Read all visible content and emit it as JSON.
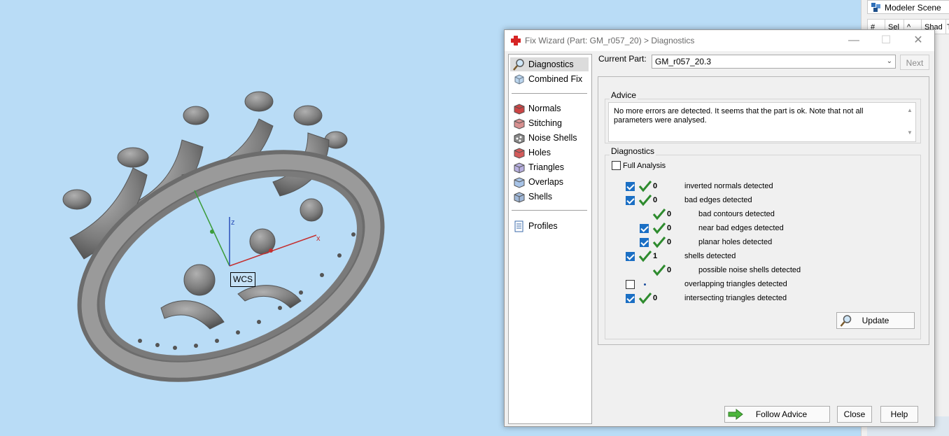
{
  "viewport": {
    "wcs_label": "WCS",
    "axis_x": "x",
    "axis_z": "z"
  },
  "scene_panel": {
    "tab_label": "Modeler Scene",
    "columns": [
      "#",
      "Sel",
      "^",
      "Shad",
      "T"
    ]
  },
  "dialog": {
    "title": "Fix Wizard (Part: GM_r057_20) > Diagnostics",
    "nav_items": [
      {
        "label": "Diagnostics",
        "icon": "magnifier-icon",
        "selected": true
      },
      {
        "label": "Combined Fix",
        "icon": "cube-icon"
      }
    ],
    "nav_items2": [
      {
        "label": "Normals",
        "icon": "normals-icon"
      },
      {
        "label": "Stitching",
        "icon": "stitching-icon"
      },
      {
        "label": "Noise Shells",
        "icon": "noise-shells-icon"
      },
      {
        "label": "Holes",
        "icon": "holes-icon"
      },
      {
        "label": "Triangles",
        "icon": "triangles-icon"
      },
      {
        "label": "Overlaps",
        "icon": "overlaps-icon"
      },
      {
        "label": "Shells",
        "icon": "shells-icon"
      }
    ],
    "nav_items3": [
      {
        "label": "Profiles",
        "icon": "profiles-icon"
      }
    ],
    "current_part_label": "Current Part:",
    "current_part_value": "GM_r057_20.3",
    "next_label": "Next",
    "advice_title": "Advice",
    "advice_text": "No more errors are detected. It seems that the part is ok. Note that not all parameters were analysed.",
    "diagnostics_title": "Diagnostics",
    "full_analysis_label": "Full Analysis",
    "full_analysis_checked": false,
    "rows": [
      {
        "checked": true,
        "status": "ok",
        "count": "0",
        "label": "inverted normals detected",
        "indent": 0
      },
      {
        "checked": true,
        "status": "ok",
        "count": "0",
        "label": "bad edges detected",
        "indent": 0
      },
      {
        "checked": null,
        "status": "ok",
        "count": "0",
        "label": "bad contours detected",
        "indent": 1
      },
      {
        "checked": true,
        "status": "ok",
        "count": "0",
        "label": "near bad edges detected",
        "indent": 1
      },
      {
        "checked": true,
        "status": "ok",
        "count": "0",
        "label": "planar holes detected",
        "indent": 1
      },
      {
        "checked": true,
        "status": "ok",
        "count": "1",
        "label": "shells detected",
        "indent": 0
      },
      {
        "checked": null,
        "status": "ok",
        "count": "0",
        "label": "possible noise shells detected",
        "indent": 1
      },
      {
        "checked": false,
        "status": "unknown",
        "count": "",
        "label": "overlapping triangles detected",
        "indent": 0
      },
      {
        "checked": true,
        "status": "ok",
        "count": "0",
        "label": "intersecting triangles detected",
        "indent": 0
      }
    ],
    "update_label": "Update",
    "follow_advice_label": "Follow Advice",
    "close_label": "Close",
    "help_label": "Help"
  },
  "colors": {
    "viewport_bg": "#b9dcf6",
    "check_blue": "#1b6fc4",
    "tick_green": "#2e8b2e",
    "model_gray": "#8a8a8a"
  }
}
